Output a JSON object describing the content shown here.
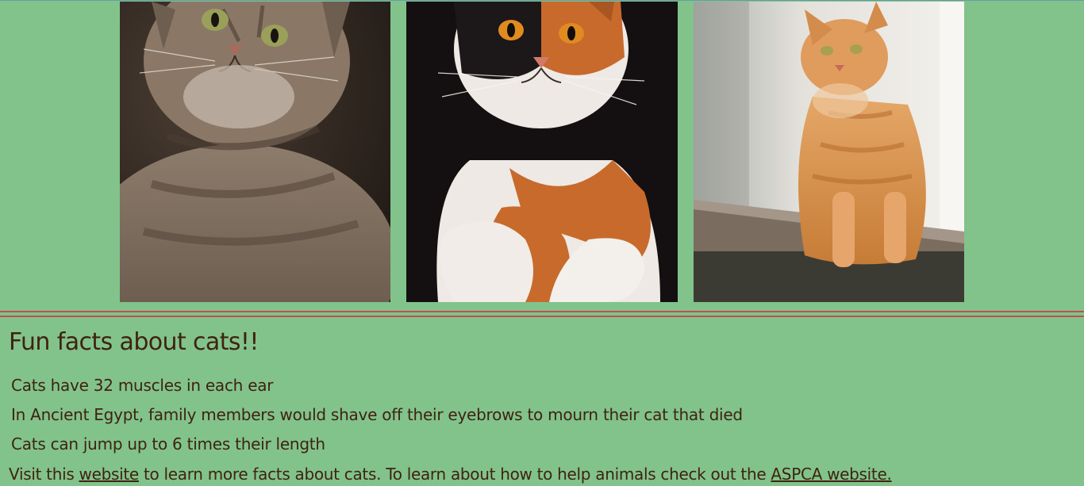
{
  "images": [
    {
      "name": "tabby-cat-photo",
      "colors": {
        "background": "#2a211c",
        "fur": "#7a6a5c",
        "eyes": "#9aa05a"
      }
    },
    {
      "name": "calico-cat-photo",
      "colors": {
        "background": "#141012",
        "fur": "#c76a2b",
        "white": "#eee9e4",
        "eyes": "#e08a20"
      }
    },
    {
      "name": "orange-cat-photo",
      "colors": {
        "background": "#e7e4df",
        "fur": "#d99650",
        "ledge": "#7a6d60",
        "eyes": "#a6a050"
      }
    }
  ],
  "heading": "Fun facts about cats!!",
  "facts": [
    "Cats have 32 muscles in each ear",
    "In Ancient Egypt, family members would shave off their eyebrows to mourn their cat that died",
    "Cats can jump up to 6 times their length"
  ],
  "footer": {
    "text_1": "Visit this ",
    "link_1": "website",
    "text_2": " to learn more facts about cats. To learn about how to help animals check out the ",
    "link_2": "ASPCA website."
  },
  "colors": {
    "page_background": "#82c38c",
    "text": "#3f2212",
    "divider": "#c0504d"
  }
}
